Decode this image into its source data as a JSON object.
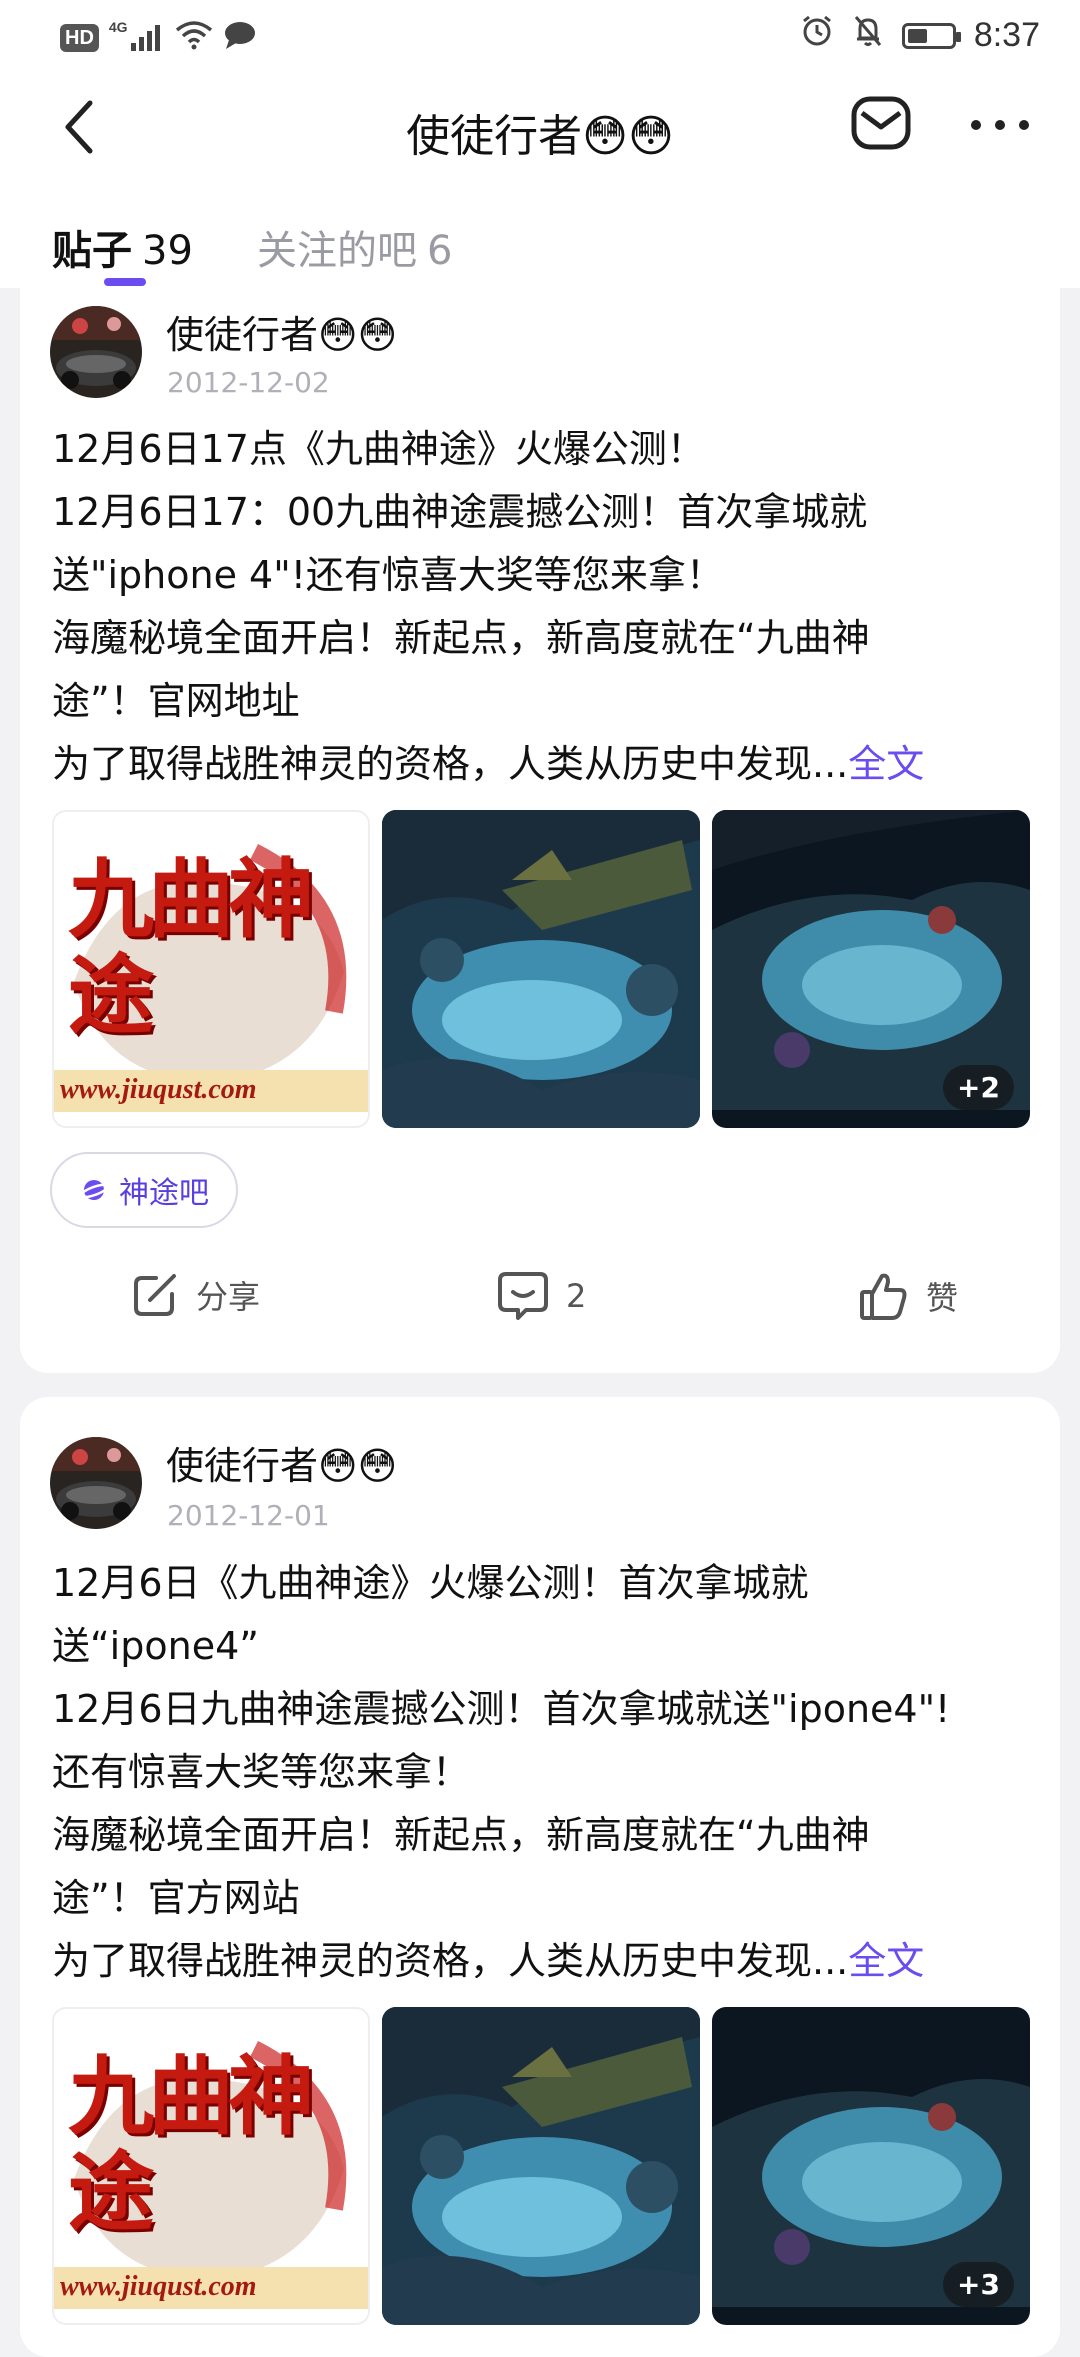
{
  "status_bar": {
    "hd": "HD",
    "network": "4G",
    "time": "8:37",
    "battery_level": 0.45
  },
  "header": {
    "title": "使徒行者😳😳"
  },
  "tabs": [
    {
      "label": "贴子",
      "count": "39",
      "active": true
    },
    {
      "label": "关注的吧",
      "count": "6",
      "active": false
    }
  ],
  "posts": [
    {
      "author": "使徒行者😳😳",
      "date": "2012-12-02",
      "lines": [
        "12月6日17点《九曲神途》火爆公测！",
        "12月6日17：00九曲神途震撼公测！首次拿城就",
        "送\"iphone 4\"!还有惊喜大奖等您来拿！",
        "海魔秘境全面开启！新起点，新高度就在“九曲神",
        "途”！官网地址",
        "为了取得战胜神灵的资格，人类从历史中发现..."
      ],
      "read_more": "全文",
      "logo_title": "九曲神途",
      "logo_url": "www.jiuqust.com",
      "extra_images": "+2",
      "forum_tag": "神途吧",
      "actions": {
        "share": "分享",
        "comments": "2",
        "like": "赞"
      }
    },
    {
      "author": "使徒行者😳😳",
      "date": "2012-12-01",
      "lines": [
        "12月6日《九曲神途》火爆公测！首次拿城就",
        "送“ipone4”",
        "12月6日九曲神途震撼公测！首次拿城就送\"ipone4\"!",
        "还有惊喜大奖等您来拿！",
        "海魔秘境全面开启！新起点，新高度就在“九曲神",
        "途”！官方网站",
        "为了取得战胜神灵的资格，人类从历史中发现..."
      ],
      "read_more": "全文",
      "logo_title": "九曲神途",
      "logo_url": "www.jiuqust.com",
      "extra_images": "+3"
    }
  ],
  "colors": {
    "accent": "#6a4cf0",
    "background": "#f2f2f4",
    "muted_text": "#9a9aa3"
  }
}
